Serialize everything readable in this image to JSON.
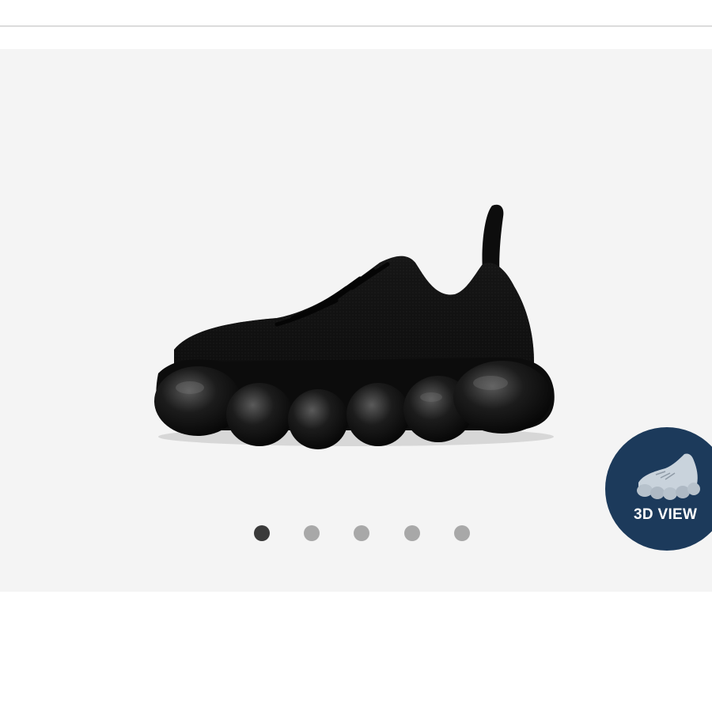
{
  "gallery": {
    "product_image": "black-knit-sneaker-bubble-sole",
    "dots": [
      {
        "active": true
      },
      {
        "active": false
      },
      {
        "active": false
      },
      {
        "active": false
      },
      {
        "active": false
      }
    ],
    "active_dot_color": "#3a3a3a",
    "inactive_dot_color": "#a8a8a8"
  },
  "view_3d": {
    "label": "3D VIEW",
    "icon": "shoe-3d-icon",
    "background_color": "#1c3a5b"
  }
}
